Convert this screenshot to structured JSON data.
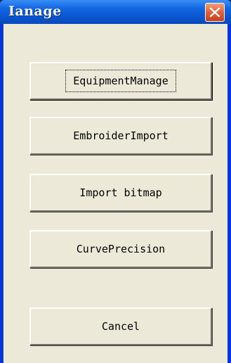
{
  "window": {
    "title": "Ianage",
    "close_icon": "close-icon"
  },
  "buttons": [
    {
      "label": "EquipmentManage",
      "focused": true
    },
    {
      "label": "EmbroiderImport",
      "focused": false
    },
    {
      "label": "Import bitmap",
      "focused": false
    },
    {
      "label": "CurvePrecision",
      "focused": false
    },
    {
      "label": "Cancel",
      "focused": false
    }
  ],
  "colors": {
    "title_bar": "#0a55d0",
    "close_button": "#e0603a",
    "client_bg": "#ece9d8"
  }
}
